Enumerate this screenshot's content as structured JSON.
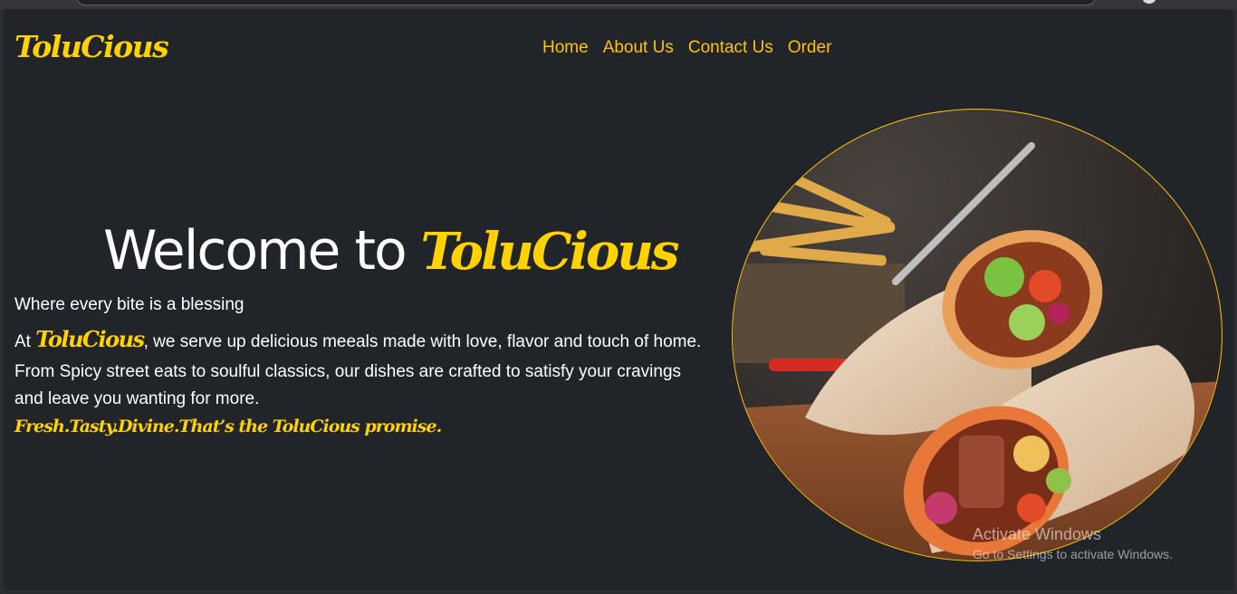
{
  "header": {
    "brand": "ToluCious",
    "nav": [
      "Home",
      "About Us",
      "Contact Us",
      "Order"
    ]
  },
  "hero": {
    "welcome_prefix": "Welcome to",
    "welcome_brand": "ToluCious",
    "tagline": "Where every bite is a blessing",
    "intro_prefix": "At",
    "intro_brand": "ToluCious",
    "intro_suffix": ", we serve up delicious meeals made with love, flavor and touch of home.",
    "description": "From Spicy street eats to soulful classics, our dishes are crafted to satisfy your cravings and leave you wanting for more.",
    "promise": "Fresh.Tasty.Divine.That’s the ToluCious promise."
  },
  "watermark": {
    "title": "Activate Windows",
    "subtitle": "Go to Settings to activate Windows."
  },
  "colors": {
    "accent": "#ffd200",
    "nav": "#ffc107",
    "background": "#212529"
  }
}
